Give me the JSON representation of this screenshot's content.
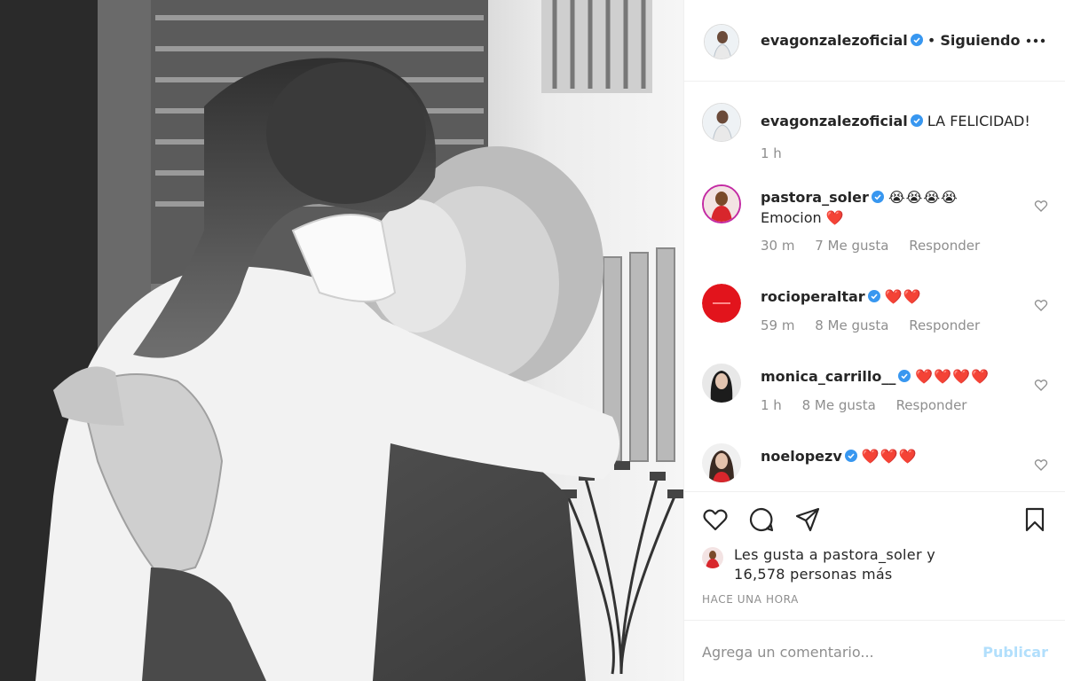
{
  "colors": {
    "verified": "#3897f0",
    "text": "#262626",
    "muted": "#8e8e8e",
    "publish_disabled": "#b2dffc",
    "heart": "#e21f26"
  },
  "header": {
    "username": "evagonzalezoficial",
    "separator": "•",
    "follow_status": "Siguiendo",
    "more_icon": "more-horizontal-icon"
  },
  "caption": {
    "username": "evagonzalezoficial",
    "text": "LA FELICIDAD!",
    "time": "1 h"
  },
  "comments": [
    {
      "username": "pastora_soler",
      "emojis": "😭😭😭😭",
      "text_line2": "Emocion",
      "heart": "❤️",
      "time": "30 m",
      "likes": "7 Me gusta",
      "reply": "Responder"
    },
    {
      "username": "rocioperaltar",
      "emojis": "❤️❤️",
      "time": "59 m",
      "likes": "8 Me gusta",
      "reply": "Responder"
    },
    {
      "username": "monica_carrillo__",
      "emojis": "❤️❤️❤️❤️",
      "time": "1 h",
      "likes": "8 Me gusta",
      "reply": "Responder"
    },
    {
      "username": "noelopezv",
      "emojis": "❤️❤️❤️"
    }
  ],
  "actions": {
    "like_icon": "heart-outline-icon",
    "comment_icon": "comment-icon",
    "share_icon": "paper-plane-icon",
    "save_icon": "bookmark-icon"
  },
  "likes": {
    "line1": "Les gusta a pastora_soler y",
    "line2": "16,578 personas más"
  },
  "timestamp": "HACE UNA HORA",
  "add_comment": {
    "placeholder": "Agrega un comentario...",
    "publish_label": "Publicar"
  }
}
